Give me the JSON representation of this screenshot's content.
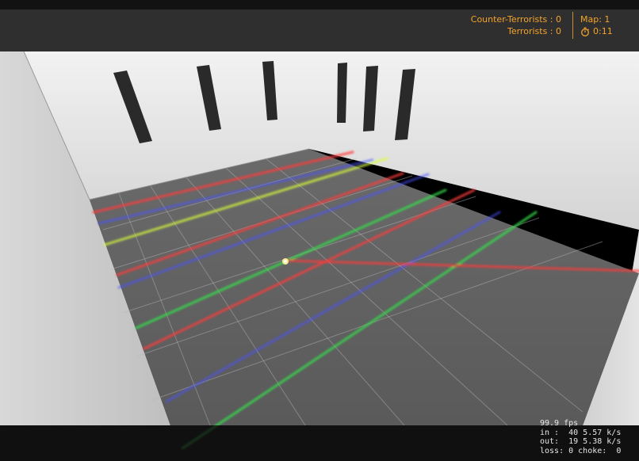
{
  "hud": {
    "counter_terrorists": "Counter-Terrorists : 0",
    "terrorists": "Terrorists : 0",
    "map": "Map: 1",
    "timer": "0:11"
  },
  "netgraph": {
    "fps": "99.9 fps",
    "in": "in :  40 5.57 k/s",
    "out": "out:  19 5.38 k/s",
    "loss": "loss: 0 choke:  0"
  },
  "colors": {
    "hud_accent": "#f4a42a",
    "laser_red": "#ff3b3b",
    "laser_green": "#35e04a",
    "laser_blue": "#4a52ff",
    "laser_yellow": "#d8ff3a"
  },
  "icons": {
    "timer": "stopwatch-icon"
  }
}
